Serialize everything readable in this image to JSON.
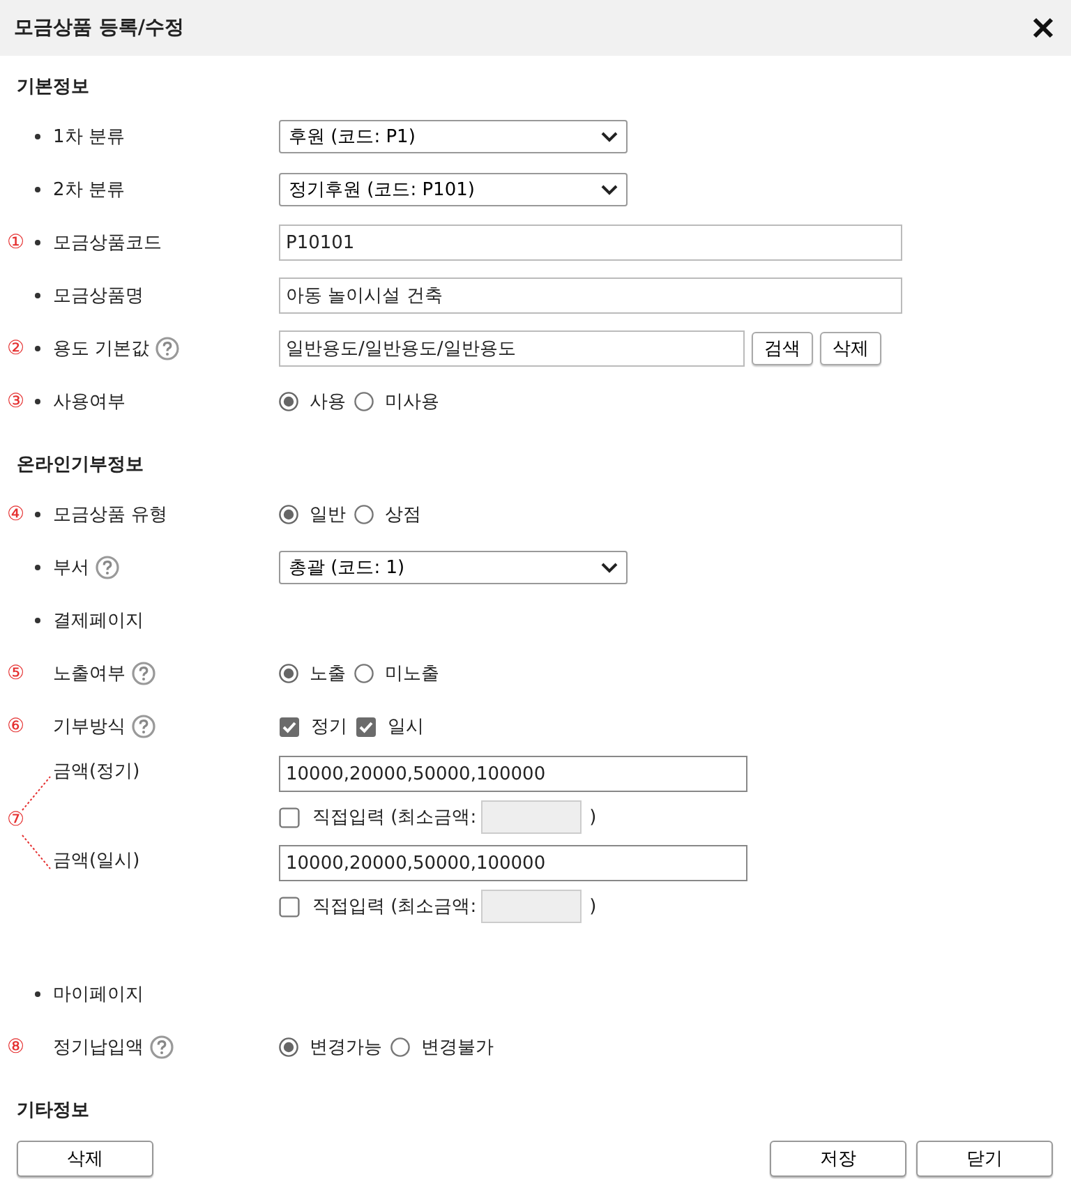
{
  "dialog": {
    "title": "모금상품 등록/수정"
  },
  "sections": [
    {
      "title": "기본정보",
      "rows": [
        {
          "kind": "select",
          "bullet": true,
          "label": "1차 분류",
          "value": "후원 (코드: P1)"
        },
        {
          "kind": "select",
          "bullet": true,
          "label": "2차 분류",
          "value": "정기후원 (코드: P101)"
        },
        {
          "kind": "text",
          "marker": "①",
          "bullet": true,
          "label": "모금상품코드",
          "value": "P10101"
        },
        {
          "kind": "text",
          "bullet": true,
          "label": "모금상품명",
          "value": "아동 놀이시설 건축"
        },
        {
          "kind": "text_buttons",
          "marker": "②",
          "bullet": true,
          "label": "용도 기본값",
          "help": true,
          "value": "일반용도/일반용도/일반용도",
          "buttons": [
            "검색",
            "삭제"
          ]
        },
        {
          "kind": "radio",
          "marker": "③",
          "bullet": true,
          "label": "사용여부",
          "options": [
            {
              "label": "사용",
              "selected": true
            },
            {
              "label": "미사용",
              "selected": false
            }
          ]
        }
      ]
    },
    {
      "title": "온라인기부정보",
      "rows": [
        {
          "kind": "radio",
          "marker": "④",
          "bullet": true,
          "label": "모금상품 유형",
          "options": [
            {
              "label": "일반",
              "selected": true
            },
            {
              "label": "상점",
              "selected": false
            }
          ]
        },
        {
          "kind": "select",
          "bullet": true,
          "label": "부서",
          "help": true,
          "value": "총괄 (코드: 1)"
        },
        {
          "kind": "none",
          "bullet": true,
          "label": "결제페이지"
        },
        {
          "kind": "radio",
          "marker": "⑤",
          "bullet": false,
          "label": "노출여부",
          "help": true,
          "options": [
            {
              "label": "노출",
              "selected": true
            },
            {
              "label": "미노출",
              "selected": false
            }
          ]
        },
        {
          "kind": "checkbox",
          "marker": "⑥",
          "bullet": false,
          "label": "기부방식",
          "help": true,
          "options": [
            {
              "label": "정기",
              "checked": true
            },
            {
              "label": "일시",
              "checked": true
            }
          ]
        },
        {
          "kind": "amounts",
          "marker": "⑦",
          "items": [
            {
              "label": "금액(정기)",
              "value": "10000,20000,50000,100000",
              "direct": {
                "label": "직접입력 (최소금액:",
                "close": ")",
                "checked": false
              }
            },
            {
              "label": "금액(일시)",
              "value": "10000,20000,50000,100000",
              "direct": {
                "label": "직접입력 (최소금액:",
                "close": ")",
                "checked": false
              }
            }
          ]
        },
        {
          "kind": "none",
          "bullet": true,
          "label": "마이페이지"
        },
        {
          "kind": "radio",
          "marker": "⑧",
          "bullet": false,
          "label": "정기납입액",
          "help": true,
          "options": [
            {
              "label": "변경가능",
              "selected": true
            },
            {
              "label": "변경불가",
              "selected": false
            }
          ]
        }
      ]
    },
    {
      "title": "기타정보"
    }
  ],
  "footer": {
    "left_buttons": [
      "삭제"
    ],
    "right_buttons": [
      "저장",
      "닫기"
    ]
  }
}
